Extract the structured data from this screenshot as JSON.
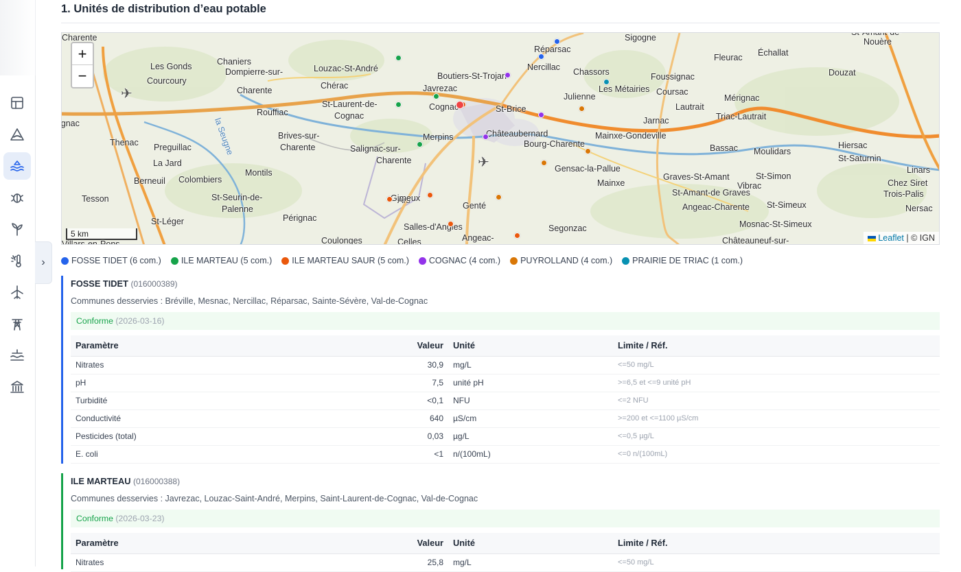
{
  "section": {
    "title": "1. Unités de distribution d’eau potable"
  },
  "sidebar": {
    "icons": [
      "layout-icon",
      "hazard-triangle-icon",
      "water-waves-icon",
      "bug-icon",
      "sprout-icon",
      "thermometer-sun-icon",
      "airplane-icon",
      "power-pylon-icon",
      "flood-level-icon",
      "monument-icon"
    ],
    "active_index": 2,
    "collapse_glyph": "›"
  },
  "map": {
    "zoom_in": "+",
    "zoom_out": "−",
    "scale": "5 km",
    "attribution_link": "Leaflet",
    "attribution_rest": " | © IGN",
    "places": [
      {
        "t": "Sigogne"
      },
      {
        "t": "Réparsac"
      },
      {
        "t": "Nercillac"
      },
      {
        "t": "Chassors"
      },
      {
        "t": "Les Métairies"
      },
      {
        "t": "Foussignac"
      },
      {
        "t": "Fleurac"
      },
      {
        "t": "Échallat"
      },
      {
        "t": "Douzat"
      },
      {
        "t": "St-Amant-de-"
      },
      {
        "t": "Nouère"
      },
      {
        "t": "Les Gonds"
      },
      {
        "t": "Courcoury"
      },
      {
        "t": "Chaniers"
      },
      {
        "t": "Dompierre-sur-"
      },
      {
        "t": "Charente"
      },
      {
        "t": "Louzac-St-André"
      },
      {
        "t": "Boutiers-St-Trojan"
      },
      {
        "t": "Chérac"
      },
      {
        "t": "Javrezac"
      },
      {
        "t": "St-Laurent-de-"
      },
      {
        "t": "Cognac"
      },
      {
        "t": "Cognac"
      },
      {
        "t": "St-Brice"
      },
      {
        "t": "Julienne"
      },
      {
        "t": "Coursac"
      },
      {
        "t": "Mérignac"
      },
      {
        "t": "Lautrait"
      },
      {
        "t": "Triac-Lautrait"
      },
      {
        "t": "Jarnac"
      },
      {
        "t": "Rouffiac"
      },
      {
        "t": "Brives-sur-"
      },
      {
        "t": "Charente"
      },
      {
        "t": "Merpins"
      },
      {
        "t": "Châteaubernard"
      },
      {
        "t": "Bourg-Charente"
      },
      {
        "t": "Mainxe-Gondeville"
      },
      {
        "t": "Bassac"
      },
      {
        "t": "Moulidars"
      },
      {
        "t": "Hiersac"
      },
      {
        "t": "St-Saturnin"
      },
      {
        "t": "Thenac"
      },
      {
        "t": "Preguillac"
      },
      {
        "t": "La Jard"
      },
      {
        "t": "Salignac-sur-"
      },
      {
        "t": "Charente"
      },
      {
        "t": "Gensac-la-Pallue"
      },
      {
        "t": "Montils"
      },
      {
        "t": "Berneuil"
      },
      {
        "t": "Colombiers"
      },
      {
        "t": "Graves-St-Amant"
      },
      {
        "t": "St-Simon"
      },
      {
        "t": "Linars"
      },
      {
        "t": "Mainxe"
      },
      {
        "t": "Vibrac"
      },
      {
        "t": "Chez Siret"
      },
      {
        "t": "St-Amant-de Graves"
      },
      {
        "t": "Trois-Palis"
      },
      {
        "t": "Tesson"
      },
      {
        "t": "Ars"
      },
      {
        "t": "Gimeux"
      },
      {
        "t": "St-Seurin-de-"
      },
      {
        "t": "Palenne"
      },
      {
        "t": "Genté"
      },
      {
        "t": "Angeac-Charente"
      },
      {
        "t": "St-Simeux"
      },
      {
        "t": "Nersac"
      },
      {
        "t": "St-Léger"
      },
      {
        "t": "Pérignac"
      },
      {
        "t": "Salles-d'Angles"
      },
      {
        "t": "Segonzac"
      },
      {
        "t": "Mosnac-St-Simeux"
      },
      {
        "t": "Coulonges"
      },
      {
        "t": "Celles"
      },
      {
        "t": "Angeac-"
      },
      {
        "t": "Châteauneuf-sur-"
      },
      {
        "t": "Villars-en-Pons"
      },
      {
        "t": "ignac"
      },
      {
        "t": "Charente"
      },
      {
        "t": "la Seugne"
      }
    ]
  },
  "legend": [
    {
      "label": "FOSSE TIDET (6 com.)",
      "color": "#2563eb"
    },
    {
      "label": "ILE MARTEAU (5 com.)",
      "color": "#16a34a"
    },
    {
      "label": "ILE MARTEAU SAUR (5 com.)",
      "color": "#ea580c"
    },
    {
      "label": "COGNAC (4 com.)",
      "color": "#9333ea"
    },
    {
      "label": "PUYROLLAND (4 com.)",
      "color": "#d97706"
    },
    {
      "label": "PRAIRIE DE TRIAC (1 com.)",
      "color": "#0891b2"
    }
  ],
  "table_headers": {
    "param": "Paramètre",
    "value": "Valeur",
    "unit": "Unité",
    "limit": "Limite / Réf."
  },
  "units": [
    {
      "name": "FOSSE TIDET",
      "code": "(016000389)",
      "color": "#2563eb",
      "communes": "Communes desservies : Bréville, Mesnac, Nercillac, Réparsac, Sainte-Sévère, Val-de-Cognac",
      "status": "Conforme",
      "date": "(2026-03-16)",
      "rows": [
        {
          "param": "Nitrates",
          "value": "30,9",
          "unit": "mg/L",
          "limit": "<=50 mg/L"
        },
        {
          "param": "pH",
          "value": "7,5",
          "unit": "unité pH",
          "limit": ">=6,5 et <=9 unité pH"
        },
        {
          "param": "Turbidité",
          "value": "<0,1",
          "unit": "NFU",
          "limit": "<=2 NFU"
        },
        {
          "param": "Conductivité",
          "value": "640",
          "unit": "µS/cm",
          "limit": ">=200 et <=1100 µS/cm"
        },
        {
          "param": "Pesticides (total)",
          "value": "0,03",
          "unit": "µg/L",
          "limit": "<=0,5 µg/L"
        },
        {
          "param": "E. coli",
          "value": "<1",
          "unit": "n/(100mL)",
          "limit": "<=0 n/(100mL)"
        }
      ]
    },
    {
      "name": "ILE MARTEAU",
      "code": "(016000388)",
      "color": "#16a34a",
      "communes": "Communes desservies : Javrezac, Louzac-Saint-André, Merpins, Saint-Laurent-de-Cognac, Val-de-Cognac",
      "status": "Conforme",
      "date": "(2026-03-23)",
      "rows": [
        {
          "param": "Nitrates",
          "value": "25,8",
          "unit": "mg/L",
          "limit": "<=50 mg/L"
        }
      ]
    }
  ]
}
